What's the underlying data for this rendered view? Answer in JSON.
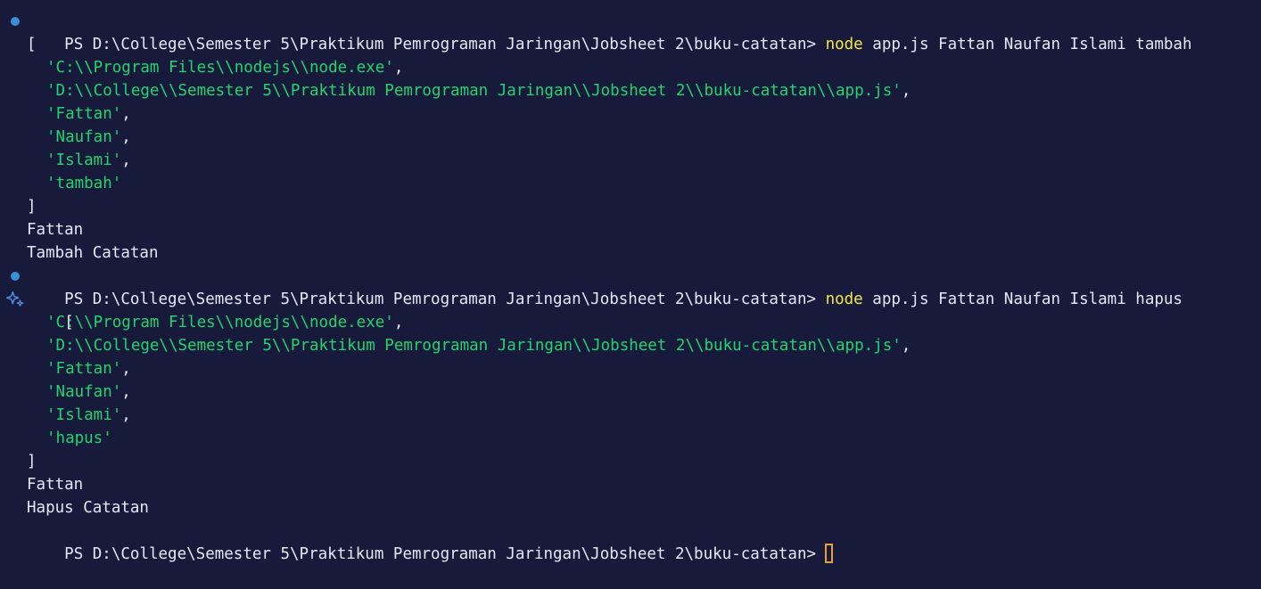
{
  "colors": {
    "background": "#171a3b",
    "text": "#e6e8f5",
    "string": "#21d46d",
    "command": "#f3e64f",
    "status_dot": "#3a8fd6",
    "cursor": "#e8a13a"
  },
  "prompt": "PS D:\\College\\Semester 5\\Praktikum Pemrograman Jaringan\\Jobsheet 2\\buku-catatan>",
  "command_name": "node",
  "run1": {
    "args": "app.js Fattan Naufan Islami tambah",
    "open_bracket": "[",
    "items": [
      "'C:\\\\Program Files\\\\nodejs\\\\node.exe'",
      "'D:\\\\College\\\\Semester 5\\\\Praktikum Pemrograman Jaringan\\\\Jobsheet 2\\\\buku-catatan\\\\app.js'",
      "'Fattan'",
      "'Naufan'",
      "'Islami'",
      "'tambah'"
    ],
    "comma": ",",
    "close_bracket": "]",
    "output1": "Fattan",
    "output2": "Tambah Catatan"
  },
  "run2": {
    "args": "app.js Fattan Naufan Islami hapus",
    "open_bracket": "[",
    "items": [
      "'C:\\\\Program Files\\\\nodejs\\\\node.exe'",
      "'D:\\\\College\\\\Semester 5\\\\Praktikum Pemrograman Jaringan\\\\Jobsheet 2\\\\buku-catatan\\\\app.js'",
      "'Fattan'",
      "'Naufan'",
      "'Islami'",
      "'hapus'"
    ],
    "comma": ",",
    "close_bracket": "]",
    "output1": "Fattan",
    "output2": "Hapus Catatan"
  },
  "icons": {
    "status_dot": "circle-dot-icon",
    "sparkle": "sparkle-icon"
  }
}
